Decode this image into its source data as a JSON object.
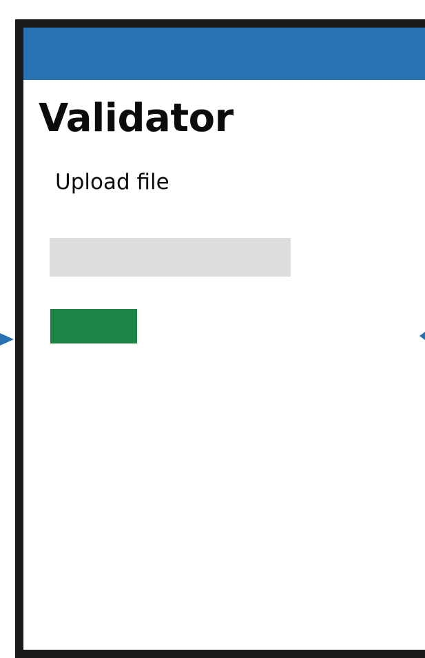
{
  "page": {
    "title": "Validator",
    "upload_label": "Upload file"
  },
  "colors": {
    "header_bar": "#2872b2",
    "file_input": "#dcdddf",
    "submit_button": "#1e8446",
    "frame_border": "#1b1b1b",
    "arrows": "#2872b2"
  },
  "icons": {
    "left_arrow": "triangle-right-arrow-icon",
    "right_arrow": "triangle-left-arrow-icon"
  }
}
